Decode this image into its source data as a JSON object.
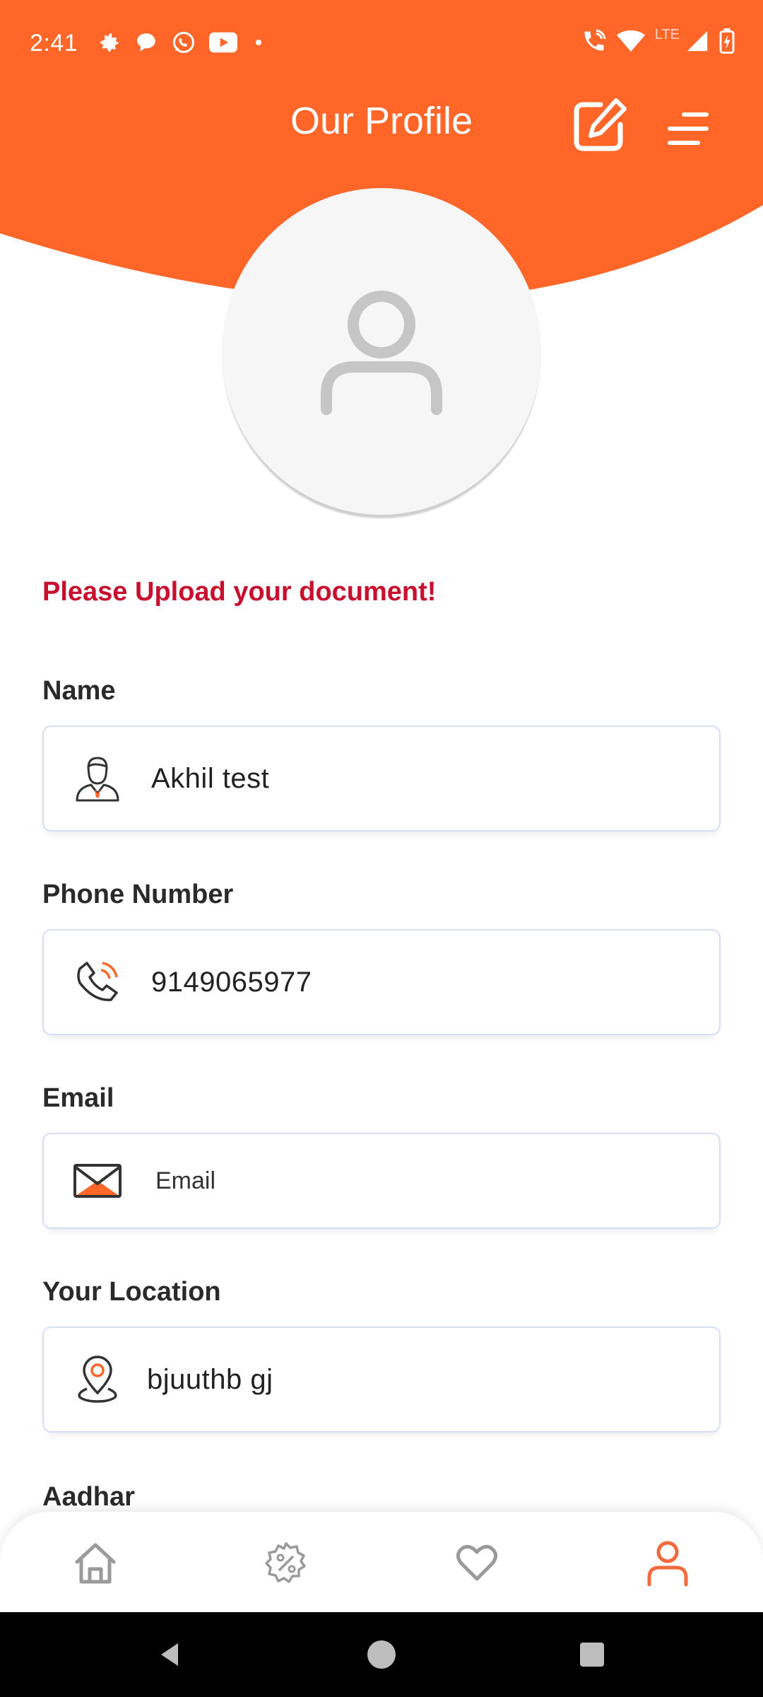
{
  "status_bar": {
    "time": "2:41",
    "network_label": "LTE",
    "left_icons": [
      "gear-icon",
      "chat-bubble-icon",
      "whatsapp-icon",
      "youtube-icon",
      "dot-icon"
    ],
    "right_icons": [
      "wifi-calling-icon",
      "wifi-icon",
      "signal-icon",
      "battery-charging-icon"
    ]
  },
  "header": {
    "title": "Our Profile",
    "edit_icon": "edit-icon",
    "menu_icon": "menu-icon",
    "color": "#ff6628"
  },
  "avatar": {
    "icon": "user-placeholder-icon"
  },
  "warning": {
    "text": "Please Upload your document!",
    "color": "#c8102e"
  },
  "form": {
    "name": {
      "label": "Name",
      "value": "Akhil test",
      "icon": "person-icon"
    },
    "phone": {
      "label": "Phone Number",
      "value": "9149065977",
      "icon": "phone-icon"
    },
    "email": {
      "label": "Email",
      "placeholder": "Email",
      "icon": "envelope-icon"
    },
    "location": {
      "label": "Your Location",
      "value": "bjuuthb gj",
      "icon": "location-pin-icon"
    },
    "aadhar": {
      "label": "Aadhar"
    }
  },
  "bottom_nav": {
    "items": [
      {
        "icon": "home-icon",
        "active": false
      },
      {
        "icon": "discount-badge-icon",
        "active": false
      },
      {
        "icon": "heart-icon",
        "active": false
      },
      {
        "icon": "profile-icon",
        "active": true
      }
    ],
    "active_color": "#f26a3c",
    "inactive_color": "#9a9a9a"
  },
  "system_nav": {
    "icons": [
      "back-icon",
      "home-circle-icon",
      "recents-icon"
    ]
  }
}
